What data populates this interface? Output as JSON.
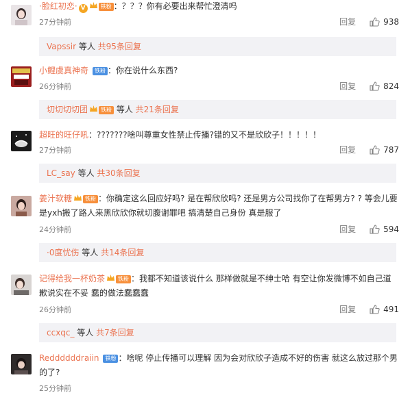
{
  "comments": [
    {
      "user": "·脸红初恋·",
      "fan_badge": "铁粉",
      "colon": "：",
      "text": "？？？你有必要出来帮忙澄清吗",
      "time": "27分钟前",
      "reply_label": "回复",
      "likes": "938",
      "sub": {
        "user": "Vapssir",
        "mid": " 等人 ",
        "link": "共95条回复"
      }
    },
    {
      "user": "小鲤虞真神奇",
      "fan_badge": "铁粉",
      "colon": "：",
      "text": "你在说什么东西?",
      "time": "26分钟前",
      "reply_label": "回复",
      "likes": "824",
      "sub": {
        "user": "切切切切团",
        "mid": " 等人 ",
        "link": "共21条回复"
      }
    },
    {
      "user": "超旺的旺仔吼",
      "colon": "：",
      "text": "???????啥叫尊重女性禁止传播?错的又不是欣欣子！！！！！",
      "time": "27分钟前",
      "reply_label": "回复",
      "likes": "787",
      "sub": {
        "user": "LC_say",
        "mid": " 等人 ",
        "link": "共30条回复"
      }
    },
    {
      "user": "姜汁软糖",
      "fan_badge": "铁粉",
      "colon": "：",
      "text": "你确定这么回应好吗? 是在帮欣欣吗? 还是男方公司找你了在帮男方? ? 等会儿要是yxh搬了路人来黑欣欣你就切腹谢罪吧 搞清楚自己身份 真是服了",
      "time": "24分钟前",
      "reply_label": "回复",
      "likes": "594",
      "sub": {
        "user": "·0度忧伤",
        "mid": " 等人 ",
        "link": "共14条回复"
      }
    },
    {
      "user": "记得给我一杯奶茶",
      "fan_badge": "铁粉",
      "colon": "：",
      "text": "我都不知道该说什么  那样做就是不绅士哈  有空让你发微博不如自己道歉说实在不妥 蠢的做法蠢蠢蠢",
      "time": "26分钟前",
      "reply_label": "回复",
      "likes": "491",
      "sub": {
        "user": "ccxqc_",
        "mid": " 等人 ",
        "link": "共7条回复"
      }
    },
    {
      "user": "Reddddddraiin",
      "fan_badge": "铁粉",
      "colon": "：",
      "text": "啥呢  停止传播可以理解  因为会对欣欣子造成不好的伤害 就这么放过那个男的了?",
      "time": "25分钟前"
    }
  ],
  "icons": {
    "verified": "v-verified-icon",
    "crown": "crown-icon",
    "like": "thumbs-up-icon"
  },
  "colors": {
    "username": "#eb7350",
    "fan_badge": "#f78f3b",
    "fan_badge_blue": "#4a90e2",
    "meta": "#808080",
    "sub_bg": "#f2f2f5"
  }
}
